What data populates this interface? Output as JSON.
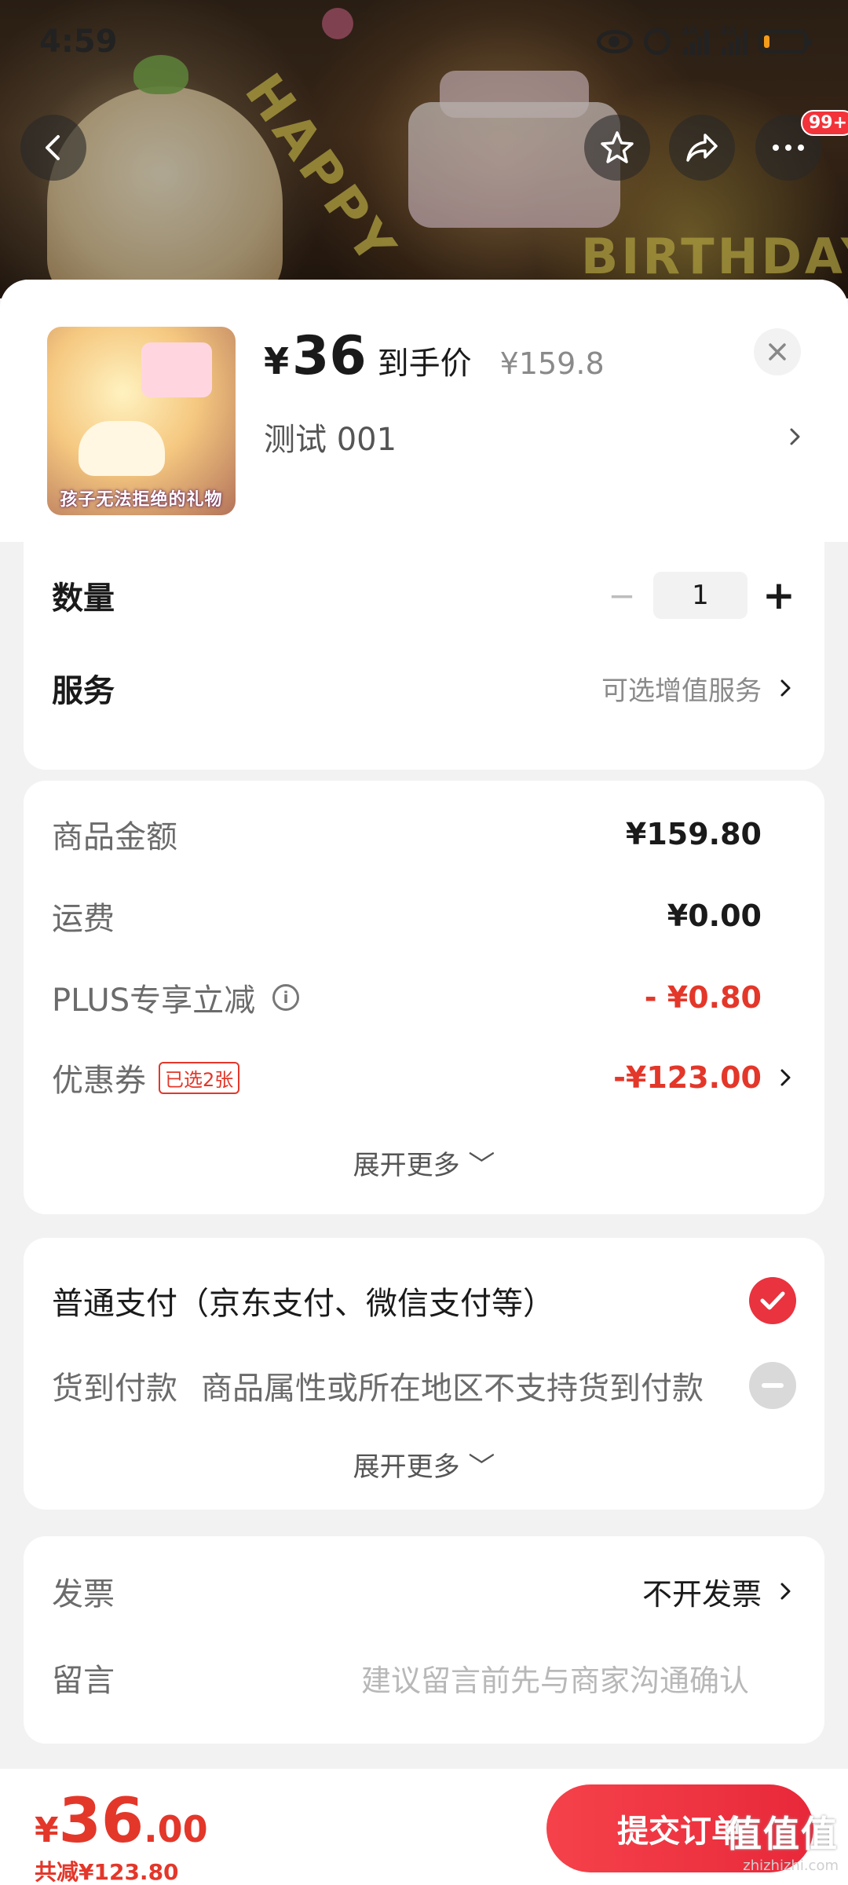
{
  "status_bar": {
    "time": "4:59",
    "signal_1": "4G",
    "signal_2": "4G",
    "battery_level": 0.15
  },
  "hero": {
    "text_1": "HAPPY",
    "text_2": "BIRTHDAY",
    "more_badge": "99+"
  },
  "product": {
    "thumb_caption": "孩子无法拒绝的礼物",
    "price_symbol": "¥",
    "price": "36",
    "price_label": "到手价",
    "original_price": "¥159.8",
    "spec": "测试  001"
  },
  "options": {
    "quantity_label": "数量",
    "quantity_minus": "−",
    "quantity_value": "1",
    "quantity_plus": "+",
    "service_label": "服务",
    "service_hint": "可选增值服务"
  },
  "costs": {
    "goods_label": "商品金额",
    "goods_value": "¥159.80",
    "shipping_label": "运费",
    "shipping_value": "¥0.00",
    "plus_label": "PLUS专享立减",
    "plus_info": "i",
    "plus_value": "- ¥0.80",
    "coupon_label": "优惠券",
    "coupon_tag": "已选2张",
    "coupon_value": "-¥123.00",
    "expand": "展开更多 ﹀"
  },
  "payment": {
    "normal_label": "普通支付（京东支付、微信支付等）",
    "cod_label": "货到付款",
    "cod_desc": "商品属性或所在地区不支持货到付款",
    "expand": "展开更多 ﹀"
  },
  "extra": {
    "invoice_label": "发票",
    "invoice_value": "不开发票",
    "note_label": "留言",
    "note_placeholder": "建议留言前先与商家沟通确认"
  },
  "footer": {
    "total_symbol": "¥",
    "total_int": "36",
    "total_dec": ".00",
    "saving": "共减¥123.80",
    "submit": "提交订单"
  },
  "watermark": {
    "main": "值值值",
    "sub": "zhizhizhi.com"
  },
  "colors": {
    "accent_red": "#e3372a",
    "button_red": "#e9333f"
  }
}
